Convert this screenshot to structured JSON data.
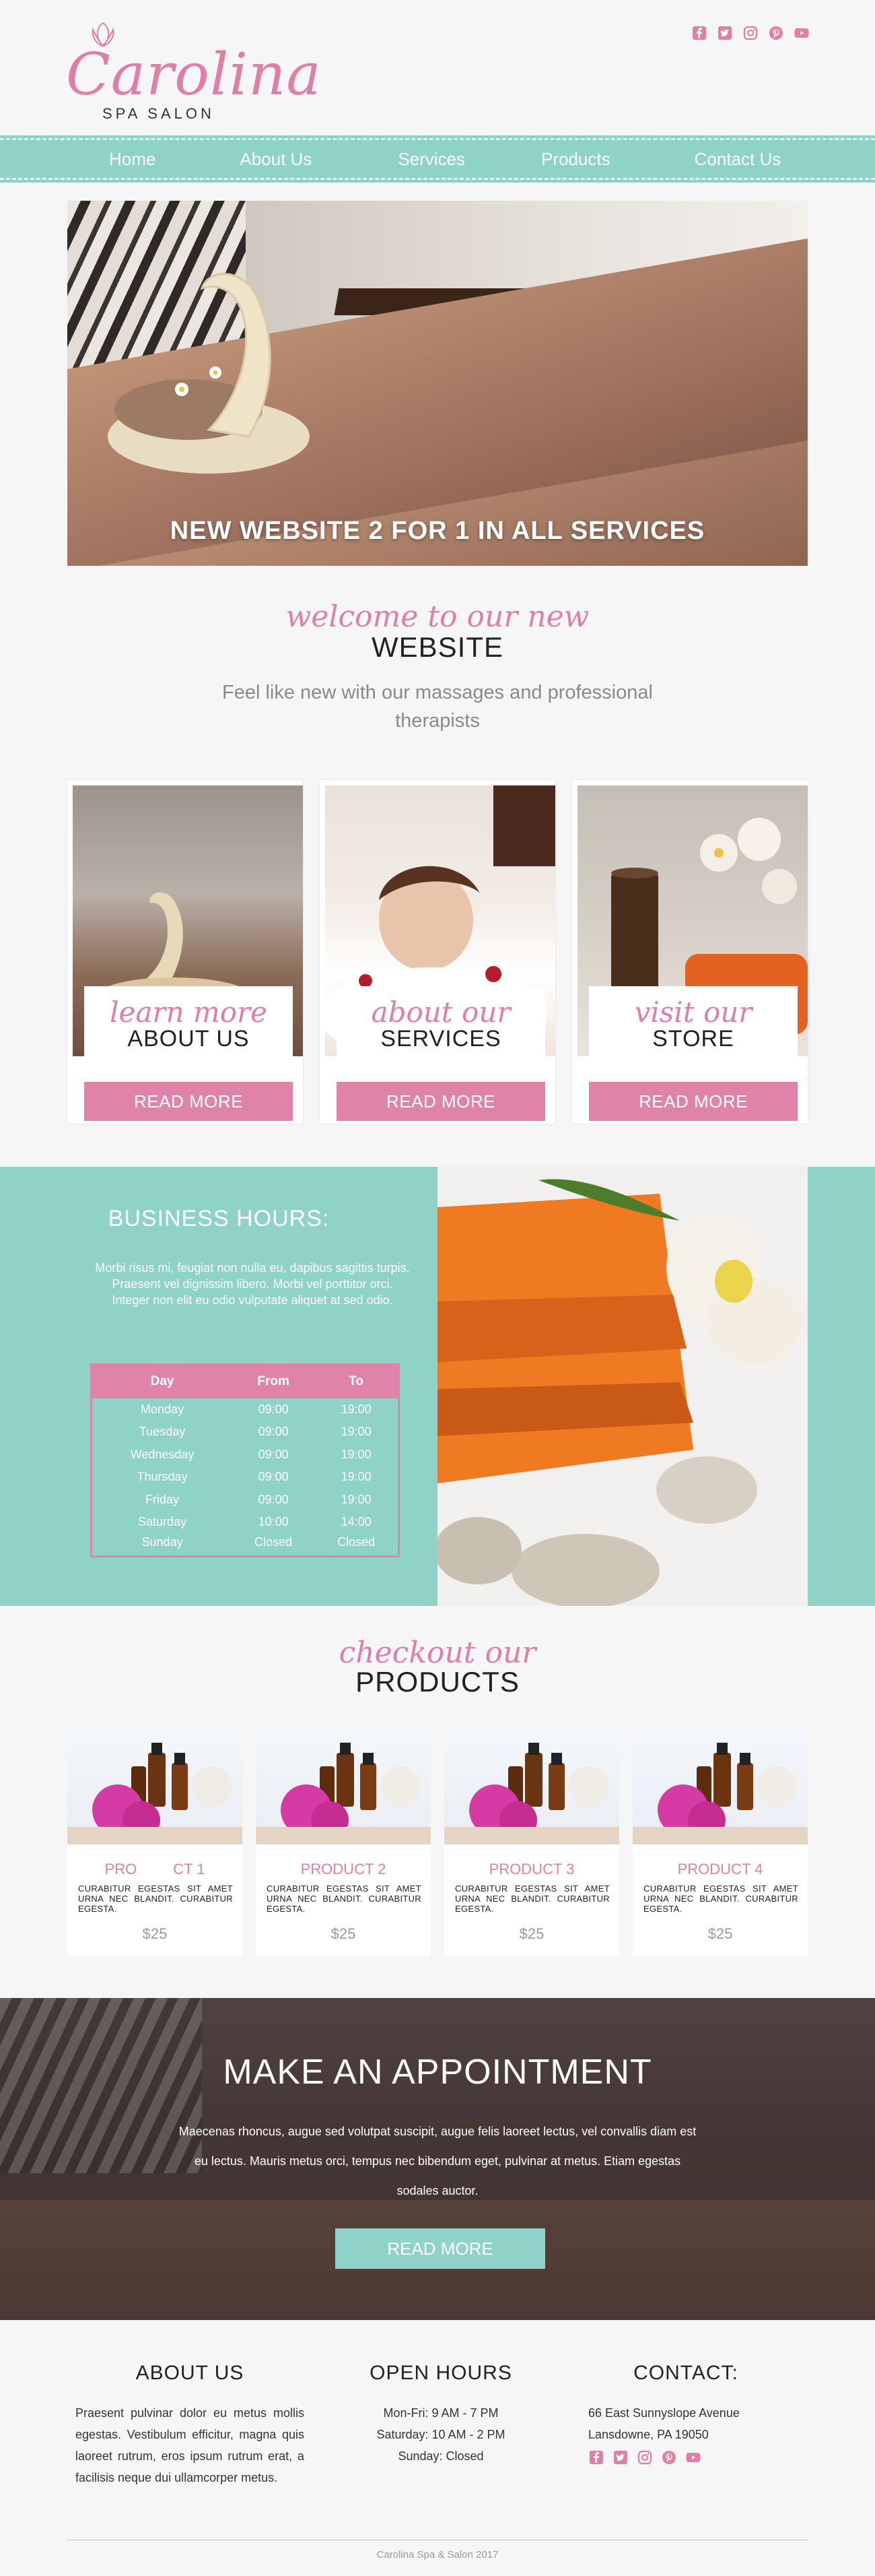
{
  "brand": {
    "name": "Carolina",
    "subtitle": "SPA SALON",
    "accent": "#e07fa6",
    "teal": "#8fd3c8"
  },
  "social": [
    "facebook-icon",
    "twitter-icon",
    "instagram-icon",
    "pinterest-icon",
    "youtube-icon"
  ],
  "nav": {
    "items": [
      {
        "label": "Home"
      },
      {
        "label": "About Us"
      },
      {
        "label": "Services"
      },
      {
        "label": "Products"
      },
      {
        "label": "Contact Us"
      }
    ]
  },
  "hero": {
    "caption": "NEW  WEBSITE 2 FOR 1 IN ALL SERVICES"
  },
  "welcome": {
    "script": "welcome to our new",
    "title": "WEBSITE",
    "lead": "Feel like new with our massages and professional therapists"
  },
  "features": [
    {
      "script": "learn more",
      "title": "ABOUT US",
      "button": "READ MORE"
    },
    {
      "script": "about our",
      "title": "SERVICES",
      "button": "READ MORE"
    },
    {
      "script": "visit our",
      "title": "STORE",
      "button": "READ MORE"
    }
  ],
  "hours": {
    "title": "BUSINESS HOURS:",
    "description": "Morbi risus mi, feugiat non nulla eu, dapibus sagittis turpis. Praesent vel dignissim libero. Morbi vel porttitor orci. Integer non elit eu odio vulputate aliquet at sed odio.",
    "headers": [
      "Day",
      "From",
      "To"
    ],
    "rows": [
      [
        "Monday",
        "09:00",
        "19:00"
      ],
      [
        "Tuesday",
        "09:00",
        "19:00"
      ],
      [
        "Wednesday",
        "09:00",
        "19:00"
      ],
      [
        "Thursday",
        "09:00",
        "19:00"
      ],
      [
        "Friday",
        "09:00",
        "19:00"
      ],
      [
        "Saturday",
        "10:00",
        "14:00"
      ],
      [
        "Sunday",
        "Closed",
        "Closed"
      ]
    ]
  },
  "products_head": {
    "script": "checkout our",
    "title": "PRODUCTS"
  },
  "products": [
    {
      "title_a": "PRO",
      "title_b": "CT 1",
      "text": "CURABITUR EGESTAS SIT AMET URNA NEC BLANDIT. CURABITUR EGESTA.",
      "price": "$25"
    },
    {
      "title": "PRODUCT 2",
      "text": "CURABITUR EGESTAS SIT AMET URNA NEC BLANDIT. CURABITUR EGESTA.",
      "price": "$25"
    },
    {
      "title": "PRODUCT 3",
      "text": "CURABITUR EGESTAS SIT AMET URNA NEC BLANDIT. CURABITUR EGESTA.",
      "price": "$25"
    },
    {
      "title": "PRODUCT 4",
      "text": "CURABITUR EGESTAS SIT AMET URNA NEC BLANDIT. CURABITUR EGESTA.",
      "price": "$25"
    }
  ],
  "appointment": {
    "title": "MAKE AN APPOINTMENT",
    "text": "Maecenas rhoncus, augue sed volutpat suscipit, augue felis laoreet lectus, vel convallis diam est eu lectus. Mauris metus orci, tempus nec bibendum eget, pulvinar at metus. Etiam egestas sodales auctor.",
    "button": "READ MORE"
  },
  "footer": {
    "about_title": "ABOUT US",
    "about_text": "Praesent pulvinar dolor eu metus mollis egestas. Vestibulum efficitur, magna quis laoreet rutrum, eros ipsum rutrum erat, a facilisis neque dui ullamcorper metus.",
    "hours_title": "OPEN HOURS",
    "hours_lines": [
      "Mon-Fri: 9 AM - 7 PM",
      "Saturday: 10 AM - 2 PM",
      "Sunday: Closed"
    ],
    "contact_title": "CONTACT:",
    "address_1": "66 East Sunnyslope Avenue",
    "address_2": "Lansdowne, PA 19050",
    "copyright": "Carolina Spa & Salon 2017"
  }
}
